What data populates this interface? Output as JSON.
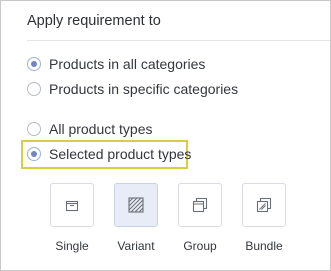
{
  "panel": {
    "title": "Apply requirement to"
  },
  "scope_options": [
    {
      "label": "Products in all categories",
      "checked": true
    },
    {
      "label": "Products in specific categories",
      "checked": false
    }
  ],
  "type_options": [
    {
      "label": "All product types",
      "checked": false
    },
    {
      "label": "Selected product types",
      "checked": true
    }
  ],
  "product_types": [
    {
      "label": "Single",
      "icon": "box-icon",
      "selected": false
    },
    {
      "label": "Variant",
      "icon": "striped-square-icon",
      "selected": true
    },
    {
      "label": "Group",
      "icon": "stacked-boxes-icon",
      "selected": false
    },
    {
      "label": "Bundle",
      "icon": "bundle-box-icon",
      "selected": false
    }
  ],
  "colors": {
    "accent": "#6f86bf",
    "highlight": "#d8cf3f",
    "selected_tile": "#e7ecf6"
  }
}
